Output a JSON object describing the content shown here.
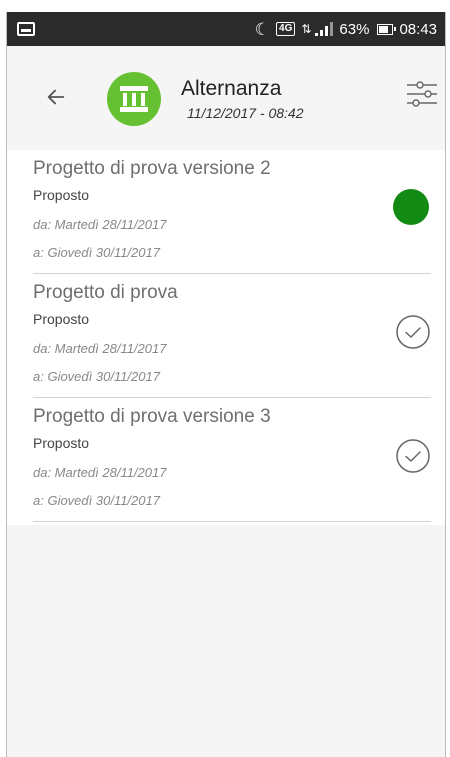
{
  "status_bar": {
    "battery": "63%",
    "time": "08:43",
    "network": "4G",
    "icons": [
      "gallery-icon",
      "moon-icon",
      "signal-icon",
      "battery-icon"
    ]
  },
  "header": {
    "title": "Alternanza",
    "subtitle": "11/12/2017 - 08:42",
    "logo_icon": "institution-icon",
    "back_icon": "arrow-left-icon",
    "filter_icon": "sliders-icon",
    "logo_color": "#66c132"
  },
  "items": [
    {
      "title": "Progetto di prova versione 2",
      "status": "Proposto",
      "from": "da: Martedì 28/11/2017",
      "to": "a: Giovedì 30/11/2017",
      "indicator": "selected-dot",
      "indicator_color": "#138a13"
    },
    {
      "title": "Progetto di prova",
      "status": "Proposto",
      "from": "da: Martedì 28/11/2017",
      "to": "a: Giovedì 30/11/2017",
      "indicator": "check-circle-icon"
    },
    {
      "title": "Progetto di prova versione 3",
      "status": "Proposto",
      "from": "da: Martedì 28/11/2017",
      "to": "a: Giovedì 30/11/2017",
      "indicator": "check-circle-icon"
    }
  ]
}
